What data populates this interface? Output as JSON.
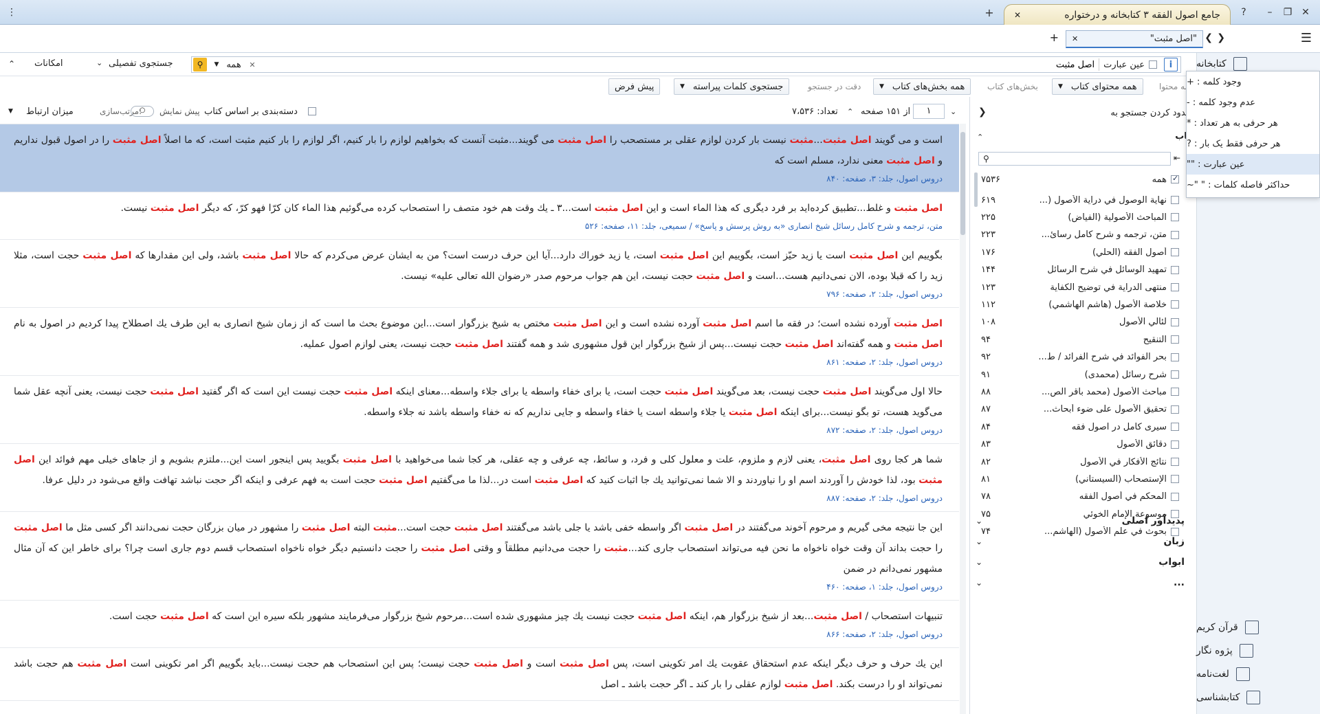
{
  "titlebar": {
    "app_title": "جامع اصول الفقه ۳ کتابخانه و درختواره",
    "help": "?",
    "menu_glyph": "⋮",
    "new_tab": "+"
  },
  "tabbar": {
    "doc_tab_label": "\"اصل مثبت\"",
    "add_tab": "+"
  },
  "search": {
    "info_glyph": "i",
    "exact_label": "عین عبارت",
    "query": "اصل مثبت",
    "scope_value": "همه",
    "advanced_label": "جستجوی تفصیلی",
    "features_label": "امکانات"
  },
  "options": {
    "content_label": "همه محتوا",
    "content_value": "همه محتوای کتاب",
    "sections_label": "بخش‌های کتاب",
    "sections_value": "همه بخش‌های کتاب",
    "precision_label": "دقت در جستجو",
    "sparse_words": "جستجوی کلمات پیراسته",
    "default_label": "پیش فرض"
  },
  "results_head": {
    "page_current": "۱",
    "page_total": "از ۱۵۱ صفحه",
    "count": "تعداد: ۷،۵۳۶",
    "group_by_book": "دسته‌بندی بر اساس کتاب",
    "preview": "پیش نمایش",
    "sort_label": "مرتب‌سازی:",
    "sort_value": "میزان ارتباط"
  },
  "results": [
    {
      "parts": [
        "است و می گویند ",
        "اصل مثبت",
        "...",
        "مثبت",
        " نیست بار کردن لوازم عقلی بر مستصحب را ",
        "اصل مثبت",
        " می گویند...مثبت آنست که بخواهیم لوازم را بار کنیم، اگر لوازم را بار کنیم مثبت است، که ما اصلاً ",
        "اصل مثبت",
        " را در اصول قبول نداریم و ",
        "اصل مثبت",
        " معنی ندارد، مسلم است که"
      ],
      "src": "دروس اصول، جلد: ۳، صفحه: ۸۴۰"
    },
    {
      "parts": [
        "اصل مثبت",
        " و غلط...تطبیق کرده‌اید بر فرد دیگری که هذا الماء است و این ",
        "اصل مثبت",
        " است...۳ ـ یك وقت هم خود متصف را استصحاب کرده می‌گوئیم هذا الماء کان کرّا فهو کرّ، که دیگر ",
        "اصل مثبت",
        " نیست."
      ],
      "src": "متن، ترجمه و شرح کامل رسائل شیخ انصاری «به روش پرسش و پاسخ» / سمیعی، جلد: ۱۱، صفحه: ۵۲۶"
    },
    {
      "parts": [
        "بگوییم این ",
        "اصل مثبت",
        " است یا زید حیّز است، بگوییم این ",
        "اصل مثبت",
        " است، یا زید خوراك دارد...آیا این حرف درست است؟ من به ایشان عرض می‌کردم که حالا ",
        "اصل مثبت",
        " باشد، ولی این مقدارها که ",
        "اصل مثبت",
        " حجت است، مثلا زید را که قبلا بوده، الان نمی‌دانیم هست...است و ",
        "اصل مثبت",
        " حجت نیست، این هم جواب مرحوم صدر «رضوان الله تعالی علیه» نیست."
      ],
      "src": "دروس اصول، جلد: ۲، صفحه: ۷۹۶"
    },
    {
      "parts": [
        "اصل مثبت",
        " آورده نشده است؛ در فقه ما اسم ",
        "اصل مثبت",
        " آورده نشده است و این ",
        "اصل مثبت",
        " مختص به شیخ بزرگوار است...این موضوع بحث ما است که از زمان شیخ انصاری به این طرف یك اصطلاح پیدا کردیم در اصول به نام ",
        "اصل مثبت",
        " و همه گفته‌اند ",
        "اصل مثبت",
        " حجت نیست...پس از شیخ بزرگوار این قول مشهوری شد و همه گفتند ",
        "اصل مثبت",
        " حجت نیست، یعنی لوازم اصول عملیه."
      ],
      "src": "دروس اصول، جلد: ۲، صفحه: ۸۶۱"
    },
    {
      "parts": [
        "حالا اول می‌گویند ",
        "اصل مثبت",
        " حجت نیست، بعد می‌گویند ",
        "اصل مثبت",
        " حجت است، یا برای خفاء واسطه یا برای جلاء واسطه...معنای اینکه ",
        "اصل مثبت",
        " حجت نیست این است که اگر گفتید ",
        "اصل مثبت",
        " حجت نیست، یعنی آنچه عقل شما می‌گوید هست، تو بگو نیست...برای اینکه ",
        "اصل مثبت",
        " یا جلاء واسطه است یا خفاء واسطه و جایی نداریم که نه خفاء واسطه باشد نه جلاء واسطه."
      ],
      "src": "دروس اصول، جلد: ۲، صفحه: ۸۷۲"
    },
    {
      "parts": [
        "شما هر کجا روی ",
        "اصل مثبت",
        "، یعنی لازم و ملزوم، علت و معلول کلی و فرد، و سائط، چه عرفی و چه عقلی، هر کجا شما می‌خواهید با ",
        "اصل مثبت",
        " بگویید پس اینجور است این...ملتزم بشویم و از جاهای خیلی مهم فوائد این ",
        "اصل مثبت",
        " بود، لذا خودش را آوردند اسم او را نیاوردند و الا شما نمی‌توانید یك جا اثبات کنید که ",
        "اصل مثبت",
        " است در...لذا ما می‌گفتیم ",
        "اصل مثبت",
        " حجت است به فهم عرفی و اینکه اگر حجت نباشد تهافت واقع می‌شود در دلیل عرفا."
      ],
      "src": "دروس اصول، جلد: ۲، صفحه: ۸۸۷"
    },
    {
      "parts": [
        "این جا نتیجه مخی گیریم و مرحوم آخوند می‌گفتند در ",
        "اصل مثبت",
        " اگر واسطه خفی باشد یا جلی باشد می‌گفتند ",
        "اصل مثبت",
        " حجت است...",
        "مثبت",
        " البته ",
        "اصل مثبت",
        " را مشهور در میان بزرگان حجت نمی‌دانند اگر کسی مثل ما ",
        "اصل مثبت",
        " را حجت بداند آن وقت خواه ناخواه ما نحن فیه می‌تواند استصحاب جاری کند...",
        "مثبت",
        " را حجت می‌دانیم مطلقاً و وقتی ",
        "اصل مثبت",
        " را حجت دانستیم دیگر خواه ناخواه استصحاب قسم دوم جاری است چرا؟ برای خاطر این که آن مثال مشهور نمی‌دانم در ضمن"
      ],
      "src": "دروس اصول، جلد: ۱، صفحه: ۴۶۰"
    },
    {
      "parts": [
        "تنبیهات استصحاب / ",
        "اصل مثبت",
        "...بعد از شیخ بزرگوار هم، اینکه ",
        "اصل مثبت",
        " حجت نیست یك چیز مشهوری شده است...مرحوم شیخ بزرگوار می‌فرمایند مشهور بلکه سیره این است که ",
        "اصل مثبت",
        " حجت است."
      ],
      "src": "دروس اصول، جلد: ۲، صفحه: ۸۶۶"
    },
    {
      "parts": [
        "این یك حرف و حرف دیگر اینکه عدم استحقاق عقوبت یك امر تکوینی است، پس ",
        "اصل مثبت",
        " است و ",
        "اصل مثبت",
        " حجت نیست؛ پس این استصحاب هم حجت نیست...باید بگوییم اگر امر تکوینی است ",
        "اصل مثبت",
        " هم حجت باشد نمی‌تواند او را درست بکند. ",
        "اصل مثبت",
        " لوازم عقلی را بار کند ـ اگر حجت باشد ـ اصل"
      ],
      "src": ""
    }
  ],
  "filter": {
    "search_in_label": "محدود کردن جستجو به",
    "books_header": "کتاب",
    "search_placeholder": "",
    "all_label": "همه",
    "all_count": "۷۵۳۶",
    "books": [
      {
        "name": "نهاية الوصول في دراية الأصول (...",
        "count": "۶۱۹"
      },
      {
        "name": "المباحث الأصولية (الفياض)",
        "count": "۲۲۵"
      },
      {
        "name": "متن، ترجمه و شرح کامل رسائ...",
        "count": "۲۲۳"
      },
      {
        "name": "أصول الفقه (الحلي)",
        "count": "۱۷۶"
      },
      {
        "name": "تمهيد الوسائل في شرح الرسائل",
        "count": "۱۴۴"
      },
      {
        "name": "منتهى الدراية في توضيح الكفاية",
        "count": "۱۲۳"
      },
      {
        "name": "خلاصة الأصول (هاشم الهاشمي)",
        "count": "۱۱۲"
      },
      {
        "name": "لئالي الأصول",
        "count": "۱۰۸"
      },
      {
        "name": "التنقيح",
        "count": "۹۴"
      },
      {
        "name": "بحر الفوائد في شرح الفرائد / ط...",
        "count": "۹۲"
      },
      {
        "name": "شرح رسائل (محمدی)",
        "count": "۹۱"
      },
      {
        "name": "مباحث الأصول (محمد باقر الص...",
        "count": "۸۸"
      },
      {
        "name": "تحقيق الأصول على ضوء أبحاث...",
        "count": "۸۷"
      },
      {
        "name": "سیری کامل در اصول فقه",
        "count": "۸۴"
      },
      {
        "name": "دقائق الأصول",
        "count": "۸۳"
      },
      {
        "name": "نتائج الأفكار في الأصول",
        "count": "۸۲"
      },
      {
        "name": "الإستصحاب (السيستاني)",
        "count": "۸۱"
      },
      {
        "name": "المحكم في أصول الفقه",
        "count": "۷۸"
      },
      {
        "name": "موسوعة الإمام الخوئي",
        "count": "۷۵"
      },
      {
        "name": "بحوث في علم الأصول (الهاشم...",
        "count": "۷۴"
      }
    ],
    "sections": [
      "پدیدآور اصلی",
      "زبان",
      "ابواب",
      "..."
    ]
  },
  "nav": {
    "library": "کتابخانه",
    "items": [
      "قرآن کریم",
      "پژوه نگار",
      "لغت‌نامه",
      "کتابشناسی"
    ]
  },
  "menu": {
    "items": [
      "وجود کلمه : +",
      "عدم وجود کلمه : -",
      "هر حرفی به هر تعداد : *",
      "هر حرفی فقط یک بار : ?",
      "عین عبارت : \"\"",
      "حداکثر فاصله کلمات : \" \"~"
    ]
  }
}
